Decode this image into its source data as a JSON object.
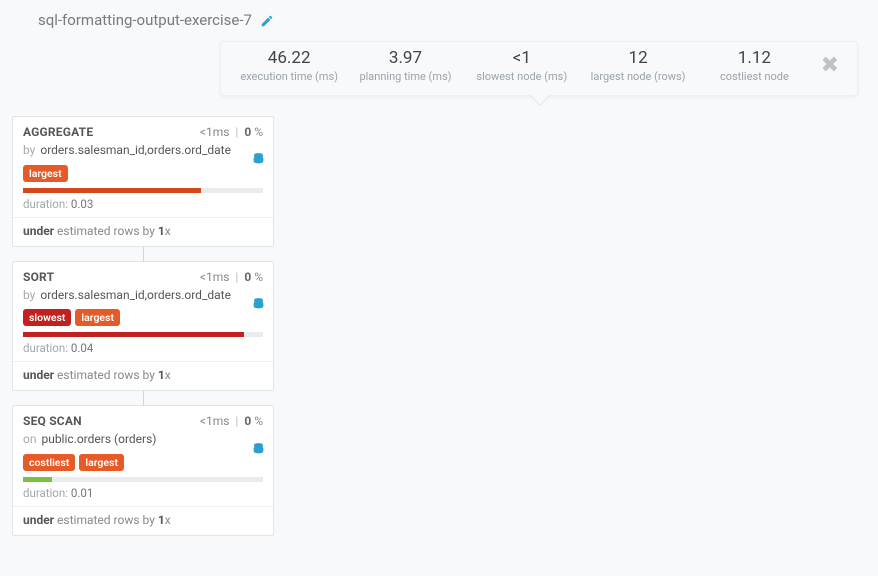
{
  "title": "sql-formatting-output-exercise-7",
  "stats": {
    "execution": {
      "value": "46.22",
      "label": "execution time (ms)"
    },
    "planning": {
      "value": "3.97",
      "label": "planning time (ms)"
    },
    "slowest": {
      "value": "<1",
      "label": "slowest node (ms)"
    },
    "largest": {
      "value": "12",
      "label": "largest node (rows)"
    },
    "costliest": {
      "value": "1.12",
      "label": "costliest node"
    }
  },
  "common": {
    "ms_suffix": "ms",
    "pct_suffix": " %",
    "sep": "|",
    "duration_label": "duration: ",
    "est_under": "under",
    "est_mid": " estimated rows by ",
    "est_factor_suffix": "x",
    "prefix_by": "by",
    "prefix_on": "on"
  },
  "nodes": [
    {
      "name": "AGGREGATE",
      "time": "<1",
      "pct": "0",
      "sub_prefix": "by",
      "sub_value": "orders.salesman_id,orders.ord_date",
      "badges": [
        "largest"
      ],
      "bar_class": "bar-orange",
      "bar_width": "74",
      "duration": "0.03",
      "est_factor": "1"
    },
    {
      "name": "SORT",
      "time": "<1",
      "pct": "0",
      "sub_prefix": "by",
      "sub_value": "orders.salesman_id,orders.ord_date",
      "badges": [
        "slowest",
        "largest"
      ],
      "bar_class": "bar-red",
      "bar_width": "92",
      "duration": "0.04",
      "est_factor": "1"
    },
    {
      "name": "SEQ SCAN",
      "time": "<1",
      "pct": "0",
      "sub_prefix": "on",
      "sub_value": "public.orders (orders)",
      "badges": [
        "costliest",
        "largest"
      ],
      "bar_class": "bar-green",
      "bar_width": "12",
      "duration": "0.01",
      "est_factor": "1"
    }
  ],
  "badge_labels": {
    "largest": "largest",
    "slowest": "slowest",
    "costliest": "costliest"
  }
}
